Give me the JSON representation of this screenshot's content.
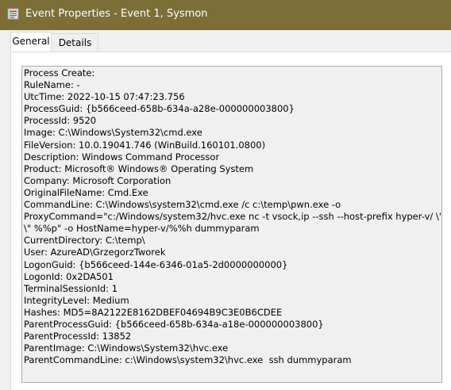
{
  "window": {
    "title": "Event Properties - Event 1, Sysmon",
    "icon": "event-viewer-icon",
    "titlebar_color": "#7d6e38"
  },
  "tabs": [
    {
      "label": "General",
      "selected": true
    },
    {
      "label": "Details",
      "selected": false
    }
  ],
  "event_text": [
    "Process Create:",
    "RuleName: -",
    "UtcTime: 2022-10-15 07:47:23.756",
    "ProcessGuid: {b566ceed-658b-634a-a28e-000000003800}",
    "ProcessId: 9520",
    "Image: C:\\Windows\\System32\\cmd.exe",
    "FileVersion: 10.0.19041.746 (WinBuild.160101.0800)",
    "Description: Windows Command Processor",
    "Product: Microsoft® Windows® Operating System",
    "Company: Microsoft Corporation",
    "OriginalFileName: Cmd.Exe",
    "CommandLine: C:\\Windows\\system32\\cmd.exe /c c:\\temp\\pwn.exe -o",
    "ProxyCommand=\"c:/Windows/system32/hvc.exe nc -t vsock,ip --ssh --host-prefix hyper-v/ \\\"%%h",
    "\\\" %%p\" -o HostName=hyper-v/%%h dummyparam",
    "CurrentDirectory: C:\\temp\\",
    "User: AzureAD\\GrzegorzTworek",
    "LogonGuid: {b566ceed-144e-6346-01a5-2d0000000000}",
    "LogonId: 0x2DA501",
    "TerminalSessionId: 1",
    "IntegrityLevel: Medium",
    "Hashes: MD5=8A2122E8162DBEF04694B9C3E0B6CDEE",
    "ParentProcessGuid: {b566ceed-658b-634a-a18e-000000003800}",
    "ParentProcessId: 13852",
    "ParentImage: C:\\Windows\\System32\\hvc.exe",
    "ParentCommandLine: c:\\Windows\\system32\\hvc.exe  ssh dummyparam"
  ]
}
